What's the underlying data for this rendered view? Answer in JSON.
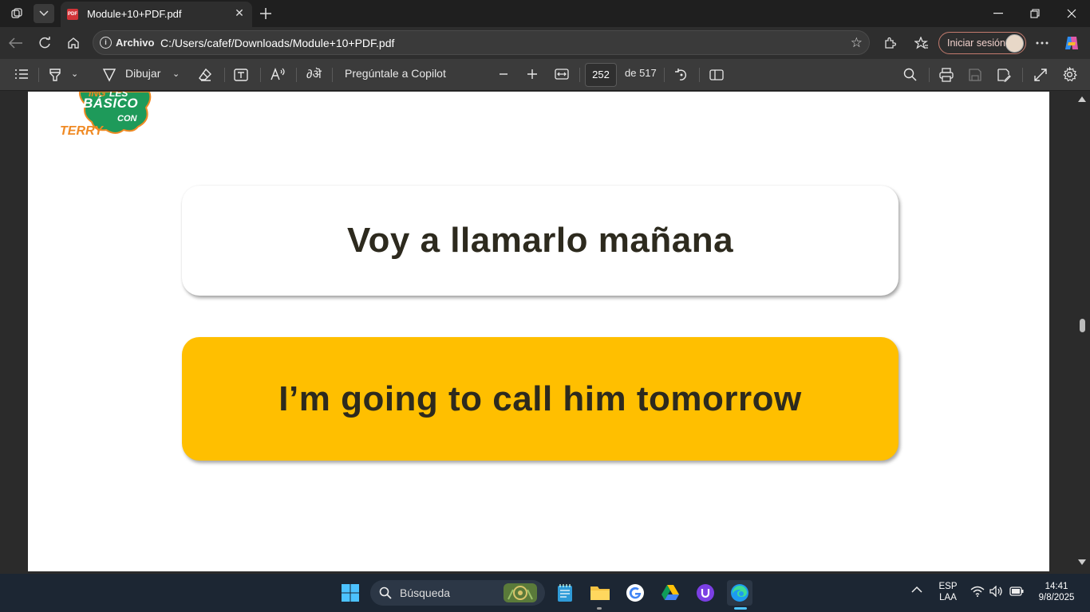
{
  "browser": {
    "tab_title": "Module+10+PDF.pdf",
    "tab_icon_text": "PDF",
    "origin_label": "Archivo",
    "url": "C:/Users/cafef/Downloads/Module+10+PDF.pdf",
    "signin_label": "Iniciar sesión"
  },
  "pdf_toolbar": {
    "draw_label": "Dibujar",
    "copilot_label": "Pregúntale a Copilot",
    "page_current": "252",
    "page_total_label": "de 517"
  },
  "page": {
    "logo_text_1": "BÁSICO",
    "logo_text_2": "CON",
    "logo_text_3": "TERRY",
    "card_spanish": "Voy a llamarlo mañana",
    "card_english": "I’m going to call him tomorrow"
  },
  "taskbar": {
    "search_placeholder": "Búsqueda",
    "lang_top": "ESP",
    "lang_bottom": "LAA",
    "time": "14:41",
    "date": "9/8/2025"
  },
  "colors": {
    "card_english_bg": "#ffbf00",
    "text_dark": "#2d2a1e",
    "logo_orange": "#f08a24",
    "logo_green": "#1e9a5a"
  }
}
